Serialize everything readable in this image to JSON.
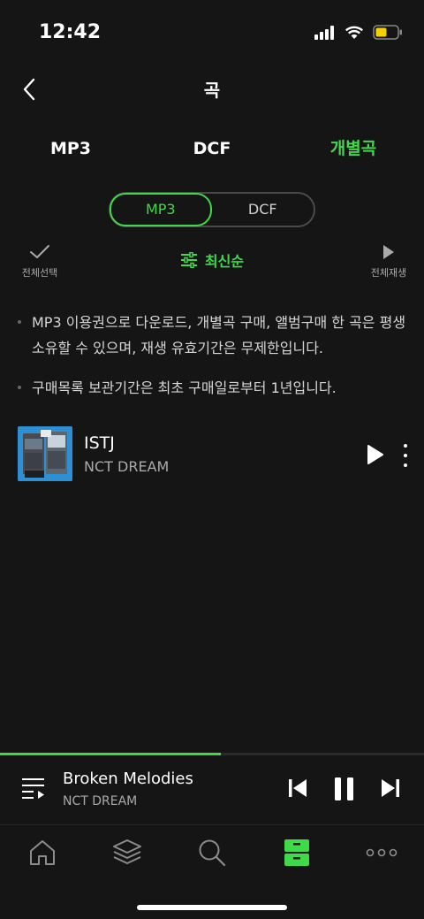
{
  "status_bar": {
    "time": "12:42"
  },
  "header": {
    "title": "곡"
  },
  "tabs": [
    {
      "label": "MP3"
    },
    {
      "label": "DCF"
    },
    {
      "label": "개별곡"
    }
  ],
  "segment": {
    "options": [
      "MP3",
      "DCF"
    ],
    "selected": "MP3"
  },
  "controls": {
    "select_all_label": "전체선택",
    "sort_label": "최신순",
    "play_all_label": "전체재생"
  },
  "notes": [
    "MP3 이용권으로 다운로드, 개별곡 구매, 앨범구매 한 곡은 평생 소유할 수 있으며, 재생 유효기간은 무제한입니다.",
    "구매목록 보관기간은 최초 구매일로부터 1년입니다."
  ],
  "songs": [
    {
      "title": "ISTJ",
      "artist": "NCT DREAM"
    }
  ],
  "now_playing": {
    "title": "Broken Melodies",
    "artist": "NCT DREAM",
    "progress": 0.52
  },
  "bottom_nav": [
    {
      "icon": "home-icon"
    },
    {
      "icon": "layers-icon"
    },
    {
      "icon": "search-icon"
    },
    {
      "icon": "storage-icon",
      "active": true
    },
    {
      "icon": "more-icon"
    }
  ],
  "colors": {
    "accent": "#3fd94a",
    "background": "#151515"
  }
}
